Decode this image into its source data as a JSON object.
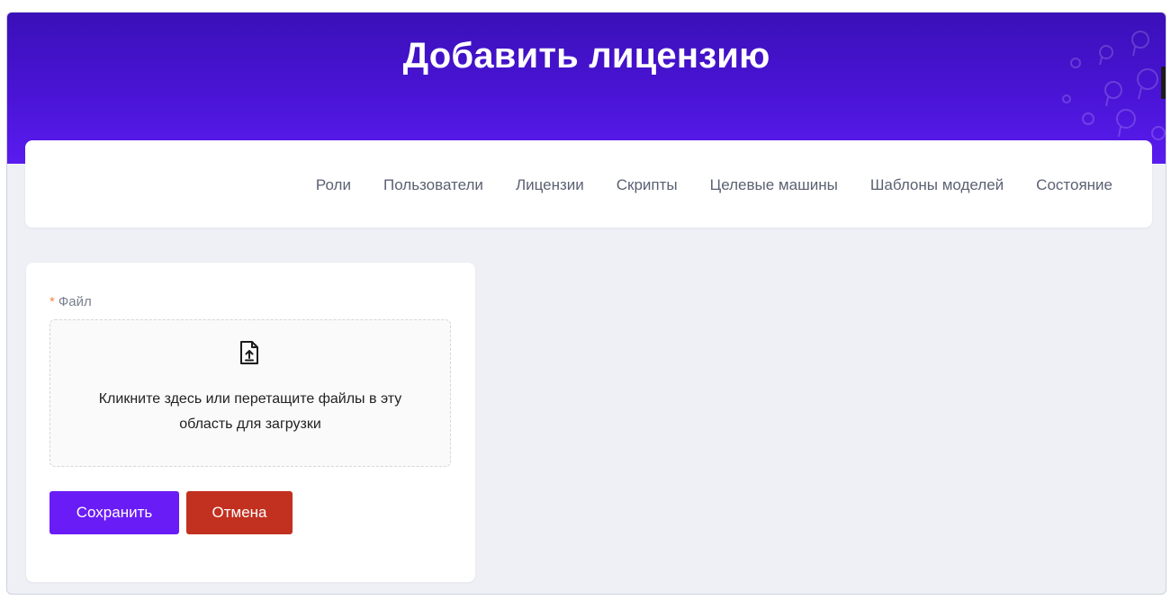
{
  "header": {
    "title": "Добавить лицензию"
  },
  "nav": {
    "items": [
      "Роли",
      "Пользователи",
      "Лицензии",
      "Скрипты",
      "Целевые машины",
      "Шаблоны моделей",
      "Состояние"
    ]
  },
  "form": {
    "file_label": "Файл",
    "required_mark": "*",
    "dropzone_text": "Кликните здесь или перетащите файлы в эту область для загрузки",
    "dropzone_icon": "file-upload-icon",
    "save_label": "Сохранить",
    "cancel_label": "Отмена"
  },
  "colors": {
    "header_gradient_top": "#3a10b8",
    "header_gradient_bottom": "#5a1cf0",
    "primary": "#6a1cf6",
    "danger": "#c23020",
    "background": "#eff0f6"
  }
}
